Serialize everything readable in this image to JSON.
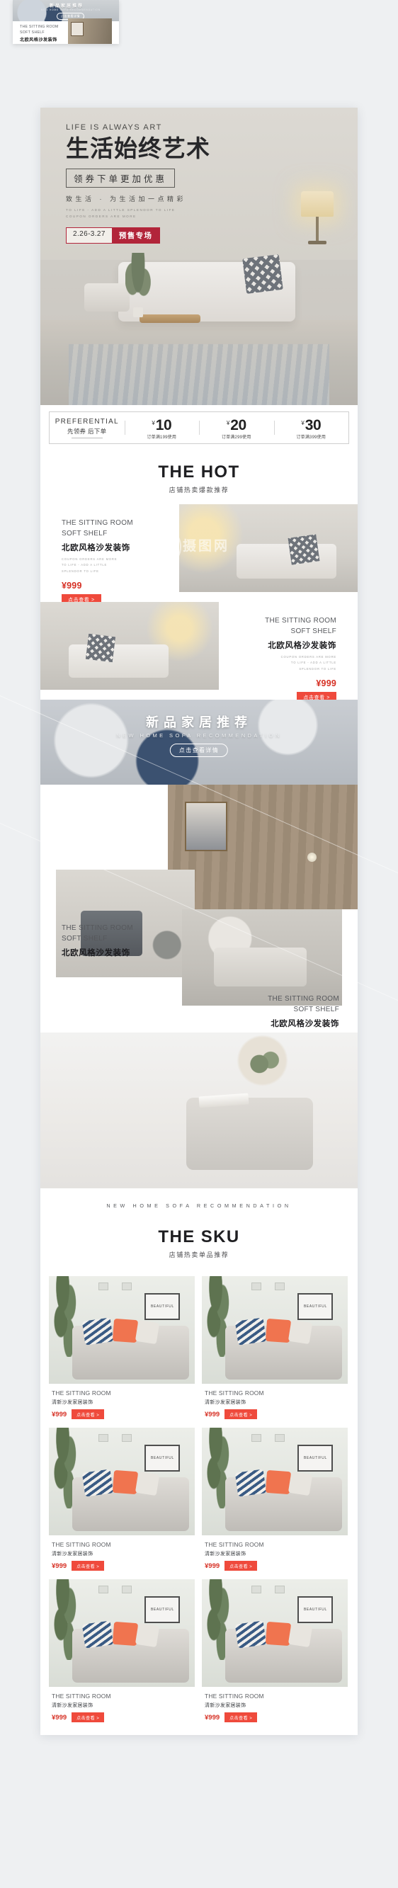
{
  "preview": {
    "title": "新品家居推荐",
    "subtitle": "NEW HOME SOFA RECOMMENDATION",
    "button": "点击查看详情",
    "card_en1": "THE SITTING ROOM",
    "card_en2": "SOFT SHELF",
    "card_cn": "北欧风格沙发装饰"
  },
  "hero": {
    "eyebrow": "LIFE IS ALWAYS ART",
    "title": "生活始终艺术",
    "tag": "领券下单更加优惠",
    "slogan": "致生活 · 为生活加一点精彩",
    "small_line1": "TO LIFE - ADD A LITTLE SPLENDOR TO LIFE",
    "small_line2": "COUPON ORDERS ARE MORE",
    "date_range": "2.26-3.27",
    "date_label": "预售专场"
  },
  "coupon": {
    "label_en": "PREFERENTIAL",
    "label_cn": "先领券 后下单",
    "currency": "¥",
    "items": [
      {
        "amount": "10",
        "condition": "订单满199使用"
      },
      {
        "amount": "20",
        "condition": "订单满299使用"
      },
      {
        "amount": "30",
        "condition": "订单满399使用"
      }
    ]
  },
  "hot_section": {
    "title_en": "THE HOT",
    "title_cn": "店铺热卖爆款推荐",
    "products": [
      {
        "en1": "THE SITTING ROOM",
        "en2": "SOFT SHELF",
        "cn": "北欧风格沙发装饰",
        "tiny1": "COUPON ORDERS ARE MORE",
        "tiny2": "TO LIFE - ADD A LITTLE",
        "tiny3": "SPLENDOR TO LIFE",
        "price": "¥999",
        "button": "点击查看 >"
      },
      {
        "en1": "THE SITTING ROOM",
        "en2": "SOFT SHELF",
        "cn": "北欧风格沙发装饰",
        "tiny1": "COUPON ORDERS ARE MORE",
        "tiny2": "TO LIFE - ADD A LITTLE",
        "tiny3": "SPLENDOR TO LIFE",
        "price": "¥999",
        "button": "点击查看 >"
      }
    ]
  },
  "new_home_banner": {
    "title": "新品家居推荐",
    "subtitle": "NEW HOME SOFA RECOMMENDATION",
    "button": "点击查看详情"
  },
  "mid_cards": [
    {
      "en1": "THE SITTING ROOM",
      "en2": "SOFT SHELF",
      "cn": "北欧风格沙发装饰"
    },
    {
      "en1": "THE SITTING ROOM",
      "en2": "SOFT SHELF",
      "cn": "北欧风格沙发装饰"
    }
  ],
  "strip_en": "NEW HOME SOFA RECOMMENDATION",
  "sku_section": {
    "title_en": "THE SKU",
    "title_cn": "店铺热卖单品推荐",
    "frame_text": "BEAUTIFUL",
    "items": [
      {
        "en": "THE SITTING ROOM",
        "cn": "清新沙发家居装饰",
        "price": "¥999",
        "button": "点击查看 >"
      },
      {
        "en": "THE SITTING ROOM",
        "cn": "清新沙发家居装饰",
        "price": "¥999",
        "button": "点击查看 >"
      },
      {
        "en": "THE SITTING ROOM",
        "cn": "清新沙发家居装饰",
        "price": "¥999",
        "button": "点击查看 >"
      },
      {
        "en": "THE SITTING ROOM",
        "cn": "清新沙发家居装饰",
        "price": "¥999",
        "button": "点击查看 >"
      },
      {
        "en": "THE SITTING ROOM",
        "cn": "清新沙发家居装饰",
        "price": "¥999",
        "button": "点击查看 >"
      },
      {
        "en": "THE SITTING ROOM",
        "cn": "清新沙发家居装饰",
        "price": "¥999",
        "button": "点击查看 >"
      }
    ]
  },
  "watermark": {
    "text": "摄图网"
  },
  "colors": {
    "accent_red": "#ef4a3c",
    "price_red": "#d63024",
    "badge_red": "#b2253a",
    "page_bg": "#eef0f2"
  }
}
